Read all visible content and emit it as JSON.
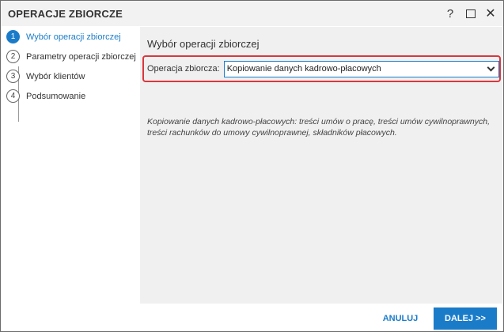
{
  "window": {
    "title": "OPERACJE ZBIORCZE",
    "help_symbol": "?",
    "close_symbol": "✕"
  },
  "steps": [
    {
      "number": "1",
      "label": "Wybór operacji zbiorczej",
      "active": true
    },
    {
      "number": "2",
      "label": "Parametry operacji zbiorczej",
      "active": false
    },
    {
      "number": "3",
      "label": "Wybór klientów",
      "active": false
    },
    {
      "number": "4",
      "label": "Podsumowanie",
      "active": false
    }
  ],
  "main": {
    "section_title": "Wybór operacji zbiorczej",
    "operation_label": "Operacja zbiorcza:",
    "operation_value": "Kopiowanie danych kadrowo-płacowych",
    "description": "Kopiowanie danych kadrowo-płacowych: treści umów o pracę, treści umów cywilnoprawnych, treści rachunków do umowy cywilnoprawnej, składników płacowych."
  },
  "footer": {
    "cancel_label": "ANULUJ",
    "next_label": "DALEJ >>"
  },
  "colors": {
    "accent": "#1a7cc9",
    "highlight_border": "#d9373e"
  }
}
